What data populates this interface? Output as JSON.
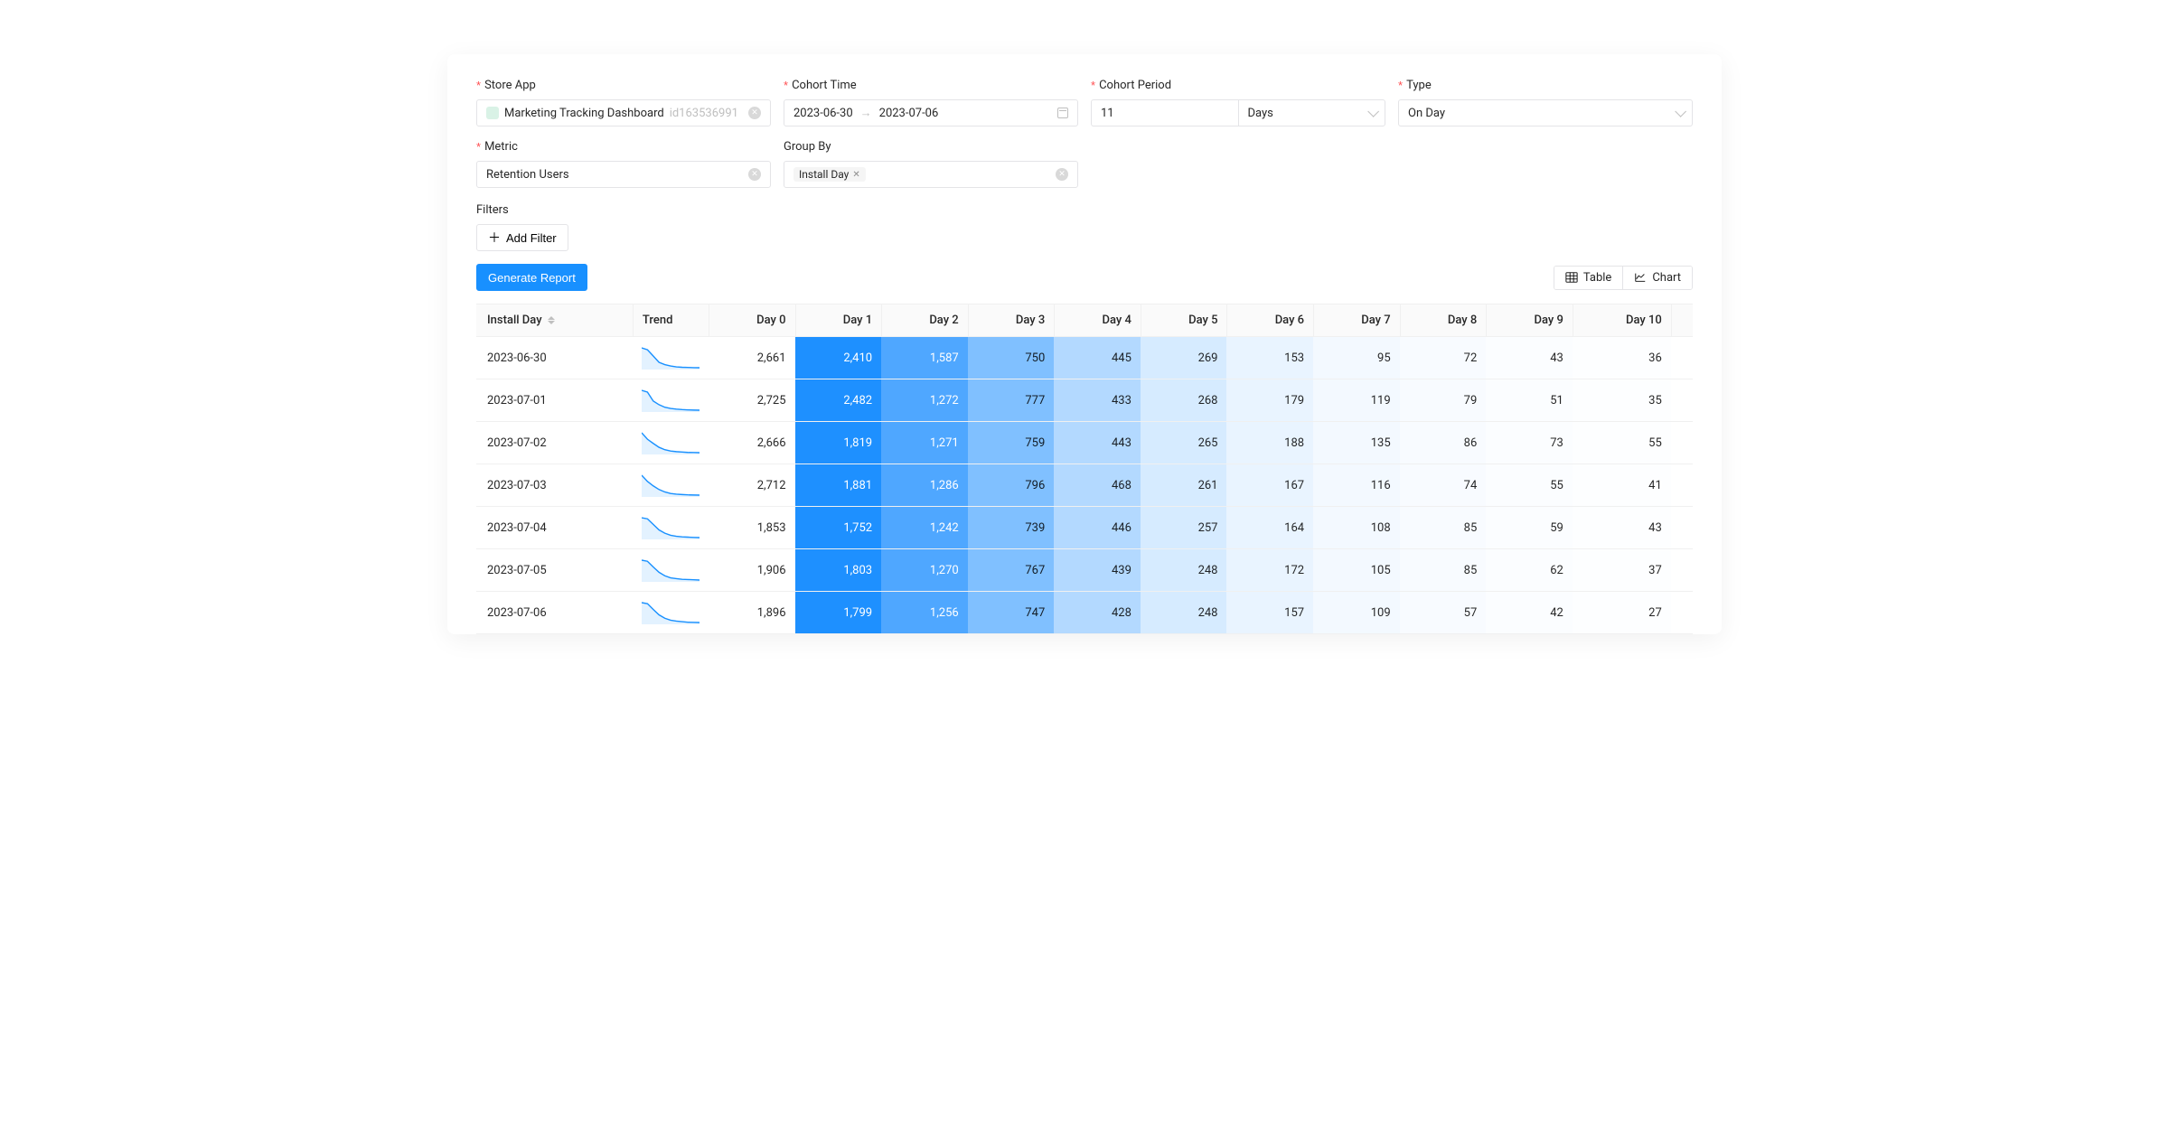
{
  "form": {
    "store_app": {
      "label": "Store App",
      "value": "Marketing Tracking Dashboard",
      "id": "id163536991"
    },
    "cohort_time": {
      "label": "Cohort Time",
      "start": "2023-06-30",
      "end": "2023-07-06"
    },
    "cohort_period": {
      "label": "Cohort Period",
      "count": "11",
      "unit": "Days"
    },
    "type": {
      "label": "Type",
      "value": "On Day"
    },
    "metric": {
      "label": "Metric",
      "value": "Retention Users"
    },
    "group_by": {
      "label": "Group By",
      "tags": [
        "Install Day"
      ]
    },
    "filters": {
      "label": "Filters",
      "add_label": "Add Filter"
    },
    "generate_label": "Generate Report",
    "view_toggle": {
      "table": "Table",
      "chart": "Chart",
      "active": "table"
    }
  },
  "table": {
    "columns": [
      "Install Day",
      "Trend",
      "Day 0",
      "Day 1",
      "Day 2",
      "Day 3",
      "Day 4",
      "Day 5",
      "Day 6",
      "Day 7",
      "Day 8",
      "Day 9",
      "Day 10"
    ],
    "rows": [
      {
        "install_day": "2023-06-30",
        "values": [
          "2,661",
          "2,410",
          "1,587",
          "750",
          "445",
          "269",
          "153",
          "95",
          "72",
          "43",
          "36"
        ]
      },
      {
        "install_day": "2023-07-01",
        "values": [
          "2,725",
          "2,482",
          "1,272",
          "777",
          "433",
          "268",
          "179",
          "119",
          "79",
          "51",
          "35"
        ]
      },
      {
        "install_day": "2023-07-02",
        "values": [
          "2,666",
          "1,819",
          "1,271",
          "759",
          "443",
          "265",
          "188",
          "135",
          "86",
          "73",
          "55"
        ]
      },
      {
        "install_day": "2023-07-03",
        "values": [
          "2,712",
          "1,881",
          "1,286",
          "796",
          "468",
          "261",
          "167",
          "116",
          "74",
          "55",
          "41"
        ]
      },
      {
        "install_day": "2023-07-04",
        "values": [
          "1,853",
          "1,752",
          "1,242",
          "739",
          "446",
          "257",
          "164",
          "108",
          "85",
          "59",
          "43"
        ]
      },
      {
        "install_day": "2023-07-05",
        "values": [
          "1,906",
          "1,803",
          "1,270",
          "767",
          "439",
          "248",
          "172",
          "105",
          "85",
          "62",
          "37"
        ]
      },
      {
        "install_day": "2023-07-06",
        "values": [
          "1,896",
          "1,799",
          "1,256",
          "747",
          "428",
          "248",
          "157",
          "109",
          "57",
          "42",
          "27"
        ]
      }
    ]
  },
  "colors": {
    "heat_scale": [
      "#1E90FF",
      "#4FA7FF",
      "#80C0FF",
      "#B3D9FF",
      "#D6EBFF",
      "#E9F4FF",
      "#F3F9FF",
      "#F8FBFF",
      "#FBFDFF",
      "#FDFEFF",
      "#FFFFFF"
    ],
    "accent": "#1890ff"
  }
}
